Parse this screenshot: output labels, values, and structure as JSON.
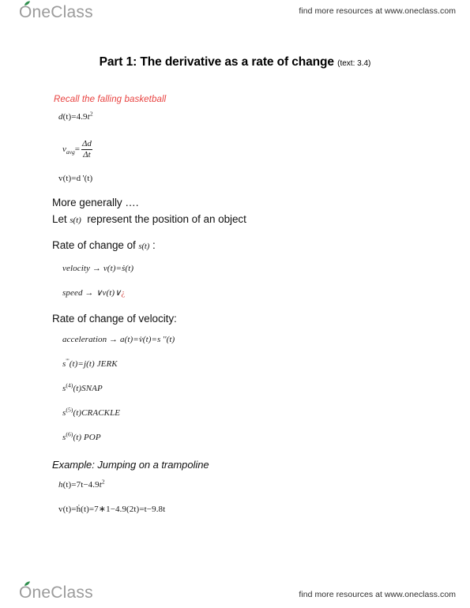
{
  "header": {
    "logo_text": "OneClass",
    "logo_icon": "apple-leaf-icon",
    "resources_note": "find more resources at www.oneclass.com"
  },
  "footer": {
    "logo_text": "OneClass",
    "logo_icon": "apple-leaf-icon",
    "resources_note": "find more resources at www.oneclass.com"
  },
  "document": {
    "title": "Part 1: The derivative as a rate of change",
    "title_reference": "(text: 3.4)",
    "recall_heading": "Recall the falling basketball",
    "equations": {
      "distance": {
        "lhs": "d",
        "arg": "(t)",
        "eq": "=4.9",
        "var": "t",
        "exp": "2"
      },
      "v_avg": {
        "lhs": "v",
        "sub": "avg",
        "eq": "=",
        "numerator": "Δd",
        "denominator": "Δt"
      },
      "velocity_def": "v(t)=d '(t)",
      "velocity_line": {
        "label": "velocity",
        "arrow": "→",
        "body": "v(t)=ṡ(t)"
      },
      "speed_line": {
        "label": "speed",
        "arrow": "→",
        "body": "∨v(t)∨",
        "trailing": "¿"
      },
      "acceleration_line": {
        "label": "acceleration",
        "arrow": "→",
        "body": "a(t)=v̇(t)=s ''(t)"
      },
      "jerk": {
        "lhs": "s",
        "primes": "'''",
        "arg": "(t)=j(t)",
        "name": "JERK"
      },
      "snap": {
        "lhs": "s",
        "sup": "(4)",
        "arg": "(t)",
        "name": "SNAP"
      },
      "crackle": {
        "lhs": "s",
        "sup": "(5)",
        "arg": "(t)",
        "name": "CRACKLE"
      },
      "pop": {
        "lhs": "s",
        "sup": "(6)",
        "arg": "(t)",
        "name": "POP"
      },
      "height": {
        "lhs": "h",
        "arg": "(t)",
        "eq": "=7t−4.9",
        "var": "t",
        "exp": "2"
      },
      "trampoline_velocity": "v(t)=ḣ(t)=7∗1−4.9(2t)=t−9.8t"
    },
    "prose": {
      "more_generally": "More generally ….",
      "let_prefix": "Let",
      "let_math": "s(t)",
      "let_suffix": "represent the position of an object",
      "rate_prefix": "Rate of change of",
      "rate_math": "s(t)",
      "rate_suffix": ":",
      "rate_velocity": "Rate of change of velocity:",
      "example_heading": "Example: Jumping on a trampoline"
    }
  },
  "colors": {
    "accent_red": "#e8413f",
    "logo_gray": "#9b9b9b",
    "leaf_green": "#2f8f4e",
    "text": "#111111"
  }
}
